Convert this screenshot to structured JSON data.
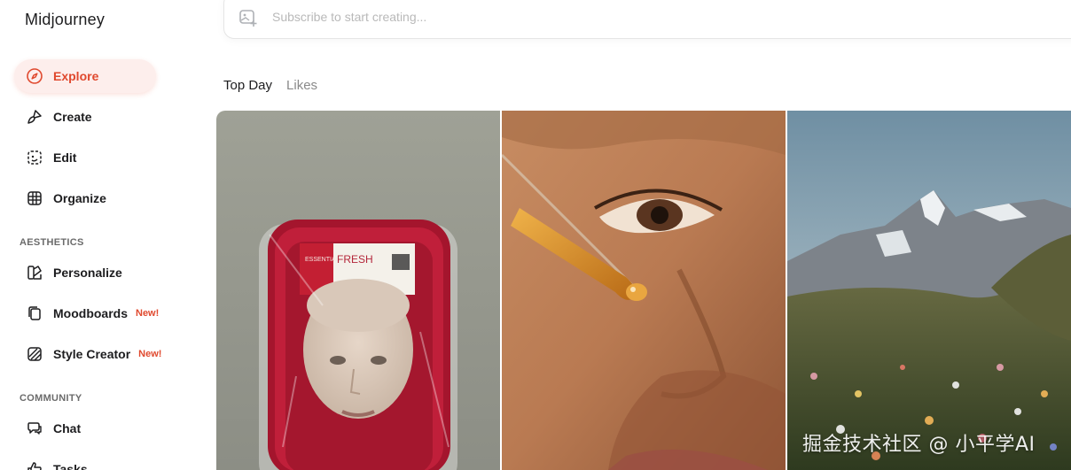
{
  "app": {
    "brand": "Midjourney"
  },
  "sidebar": {
    "items": [
      {
        "label": "Explore",
        "icon": "compass-icon",
        "active": true
      },
      {
        "label": "Create",
        "icon": "brush-icon"
      },
      {
        "label": "Edit",
        "icon": "edit-frame-icon"
      },
      {
        "label": "Organize",
        "icon": "grid-icon"
      }
    ],
    "aesthetics_title": "AESTHETICS",
    "aesthetics": [
      {
        "label": "Personalize",
        "icon": "palette-icon"
      },
      {
        "label": "Moodboards",
        "icon": "cards-icon",
        "badge": "New!"
      },
      {
        "label": "Style Creator",
        "icon": "stripes-icon",
        "badge": "New!"
      }
    ],
    "community_title": "COMMUNITY",
    "community": [
      {
        "label": "Chat",
        "icon": "chat-icon"
      },
      {
        "label": "Tasks",
        "icon": "thumbs-up-icon"
      }
    ]
  },
  "search": {
    "placeholder": "Subscribe to start creating..."
  },
  "tabs": [
    {
      "label": "Top Day",
      "active": true
    },
    {
      "label": "Likes"
    }
  ],
  "gallery": [
    {
      "alt": "mannequin face packaged in red tray",
      "package_brand": "FRESH",
      "package_subtitle": "ESSENTIAL FACE"
    },
    {
      "alt": "serum dropper close to face"
    },
    {
      "alt": "mountain meadow with wildflowers"
    }
  ],
  "watermark": "掘金技术社区 @ 小平学AI",
  "colors": {
    "accent": "#e0492e",
    "active_bg": "#fdeeec"
  }
}
